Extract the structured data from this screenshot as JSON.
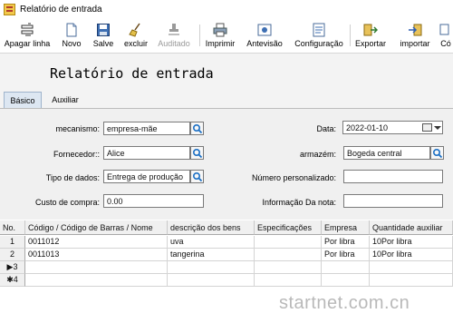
{
  "window": {
    "title": "Relatório de entrada"
  },
  "toolbar": {
    "items": [
      {
        "label": "Apagar linha",
        "icon": "delete-row-icon"
      },
      {
        "label": "Novo",
        "icon": "new-document-icon"
      },
      {
        "label": "Salve",
        "icon": "save-icon"
      },
      {
        "label": "excluir",
        "icon": "broom-icon"
      },
      {
        "label": "Auditado",
        "icon": "audit-stamp-icon",
        "disabled": true
      },
      {
        "label": "Imprimir",
        "icon": "printer-icon"
      },
      {
        "label": "Antevisão",
        "icon": "preview-icon"
      },
      {
        "label": "Configuração",
        "icon": "settings-icon"
      },
      {
        "label": "Exportar",
        "icon": "export-icon"
      },
      {
        "label": "importar",
        "icon": "import-icon"
      },
      {
        "label": "Có",
        "icon": "copy-icon"
      }
    ]
  },
  "report": {
    "title": "Relatório de entrada"
  },
  "tabs": [
    {
      "label": "Básico",
      "active": true
    },
    {
      "label": "Auxiliar",
      "active": false
    }
  ],
  "form": {
    "mecanismo": {
      "label": "mecanismo:",
      "value": "empresa-mãe"
    },
    "fornecedor": {
      "label": "Fornecedor::",
      "value": "Alice"
    },
    "tipo": {
      "label": "Tipo de dados:",
      "value": "Entrega de produção"
    },
    "custo": {
      "label": "Custo de compra:",
      "value": "0.00"
    },
    "data": {
      "label": "Data:",
      "value": "2022-01-10"
    },
    "armazem": {
      "label": "armazém:",
      "value": "Bogeda central"
    },
    "numero": {
      "label": "Número personalizado:",
      "value": ""
    },
    "informacao": {
      "label": "Informação Da nota:",
      "value": ""
    }
  },
  "grid": {
    "columns": [
      "No.",
      "Código / Código de Barras / Nome",
      "descrição dos bens",
      "Especificações",
      "Empresa",
      "Quantidade auxiliar"
    ],
    "rows": [
      {
        "no": "1",
        "codigo": "0011012",
        "descricao": "uva",
        "especificacoes": "",
        "empresa": "Por libra",
        "quantidade": "10Por libra"
      },
      {
        "no": "2",
        "codigo": "0011013",
        "descricao": "tangerina",
        "especificacoes": "",
        "empresa": "Por libra",
        "quantidade": "10Por libra"
      },
      {
        "no": "▶3",
        "codigo": "",
        "descricao": "",
        "especificacoes": "",
        "empresa": "",
        "quantidade": ""
      },
      {
        "no": "✱4",
        "codigo": "",
        "descricao": "",
        "especificacoes": "",
        "empresa": "",
        "quantidade": ""
      }
    ]
  },
  "watermark": "startnet.com.cn",
  "colors": {
    "panel_bg": "#f0f0f0",
    "tab_active": "#dde7f2",
    "search_icon": "#1b6fc4",
    "watermark": "#b9b9b9"
  }
}
